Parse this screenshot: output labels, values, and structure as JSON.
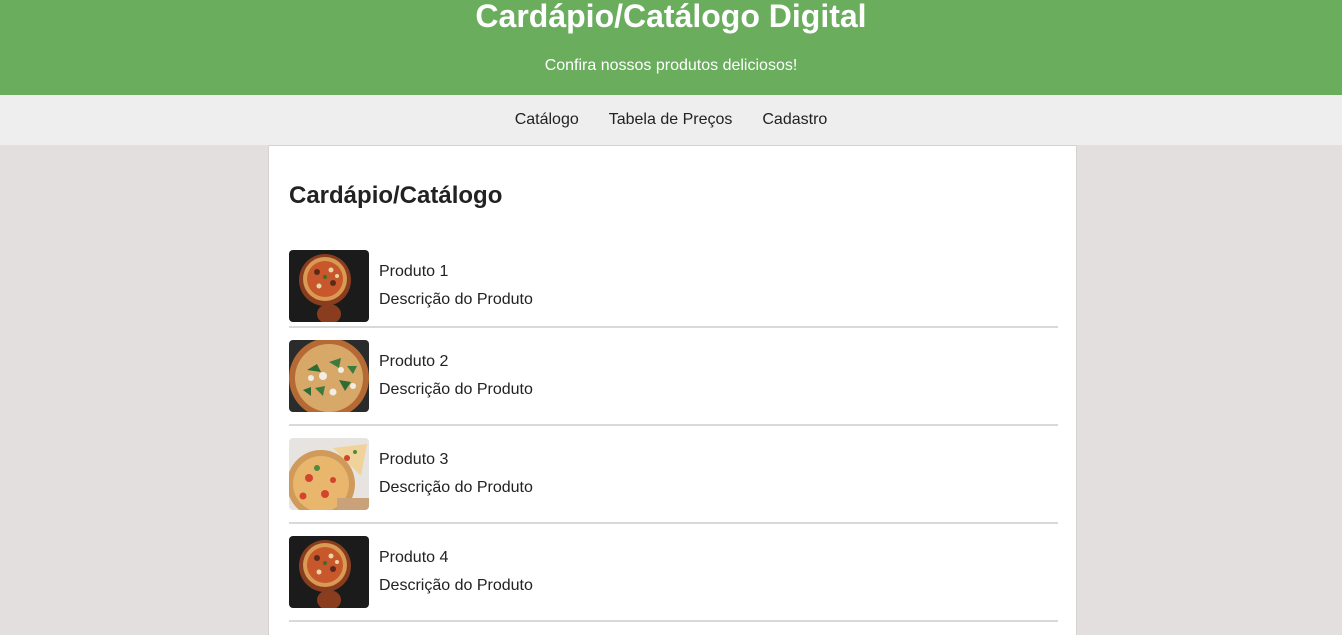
{
  "header": {
    "title": "Cardápio/Catálogo Digital",
    "subtitle": "Confira nossos produtos deliciosos!"
  },
  "nav": {
    "items": [
      {
        "label": "Catálogo"
      },
      {
        "label": "Tabela de Preços"
      },
      {
        "label": "Cadastro"
      }
    ]
  },
  "main": {
    "title": "Cardápio/Catálogo",
    "products": [
      {
        "name": "Produto 1",
        "description": "Descrição do Produto",
        "image": "pizza-on-board-image"
      },
      {
        "name": "Produto 2",
        "description": "Descrição do Produto",
        "image": "pizza-spinach-image"
      },
      {
        "name": "Produto 3",
        "description": "Descrição do Produto",
        "image": "pizza-slice-image"
      },
      {
        "name": "Produto 4",
        "description": "Descrição do Produto",
        "image": "pizza-on-board-image"
      }
    ]
  },
  "colors": {
    "header_bg": "#69ad5d",
    "nav_bg": "#eeeeee",
    "page_bg": "#e3dfdf",
    "card_bg": "#ffffff"
  }
}
